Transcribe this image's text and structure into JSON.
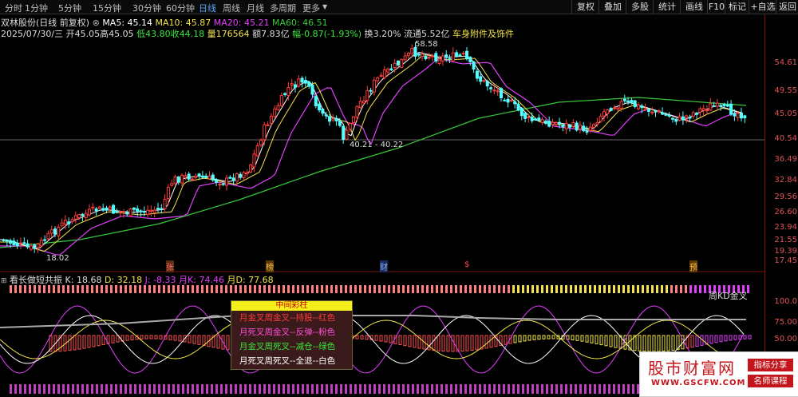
{
  "toolbar": {
    "tabs": [
      "分时",
      "1分钟",
      "5分钟",
      "15分钟",
      "30分钟",
      "60分钟",
      "日线",
      "周线",
      "月线",
      "多周期",
      "更多"
    ],
    "active_tab": "日线",
    "right_buttons": [
      "复权",
      "叠加",
      "多股",
      "统计",
      "画线",
      "F10",
      "标记",
      "+自选",
      "返回"
    ]
  },
  "stock": {
    "title": "双林股份(日线 前复权)",
    "ma5": "MA5: 45.14",
    "ma10": "MA10: 45.87",
    "ma20": "MA20: 45.21",
    "ma60": "MA60: 46.51",
    "date": "2025/07/30/三",
    "open": "开45.05",
    "high": "高45.05",
    "low": "低43.80",
    "close": "收44.18",
    "volume": "量176564",
    "amount": "额7.83亿",
    "change": "幅-0.87(-1.93%)",
    "turnover": "换3.20%",
    "float": "流通5.52亿",
    "sector": "车身附件及饰件"
  },
  "price_axis": [
    "54.61",
    "49.55",
    "45.05",
    "40.54",
    "36.49",
    "32.84",
    "29.56",
    "26.60",
    "23.94",
    "21.55",
    "19.39",
    "17.45"
  ],
  "annotations": {
    "high_mark": "58.58",
    "low_mark": "18.02",
    "gap_label": "40.21 - 40.22",
    "event_markers": [
      "张",
      "榜",
      "财",
      "$",
      "预"
    ]
  },
  "indicator": {
    "name": "看长做短共振",
    "k": "K: 18.68",
    "d": "D: 32.18",
    "j": "J: -8.33",
    "month_k": "月K: 74.46",
    "month_d": "月D: 77.68",
    "axis": [
      "100.0",
      "75.00",
      "50.00"
    ],
    "side_label": "周KD金叉"
  },
  "legend": {
    "title": "中间彩柱",
    "rows": [
      {
        "text": "月金叉周金叉--持股--红色",
        "color": "#ff3b3b"
      },
      {
        "text": "月死叉周金叉--反弹--粉色",
        "color": "#ff4fd8"
      },
      {
        "text": "月金叉周死叉--减仓--绿色",
        "color": "#39e639"
      },
      {
        "text": "月死叉周死叉--全退--白色",
        "color": "#ffffff"
      }
    ]
  },
  "watermark": {
    "title": "股市财富网",
    "url": "WWW.GSCFW.COM",
    "tag1": "指标分享",
    "tag2": "名师课程"
  },
  "colors": {
    "up": "#ff3b3b",
    "down": "#54ffff",
    "ma5": "#ffffff",
    "ma10": "#f2e34a",
    "ma20": "#e040fb",
    "ma60": "#37c83a"
  }
}
